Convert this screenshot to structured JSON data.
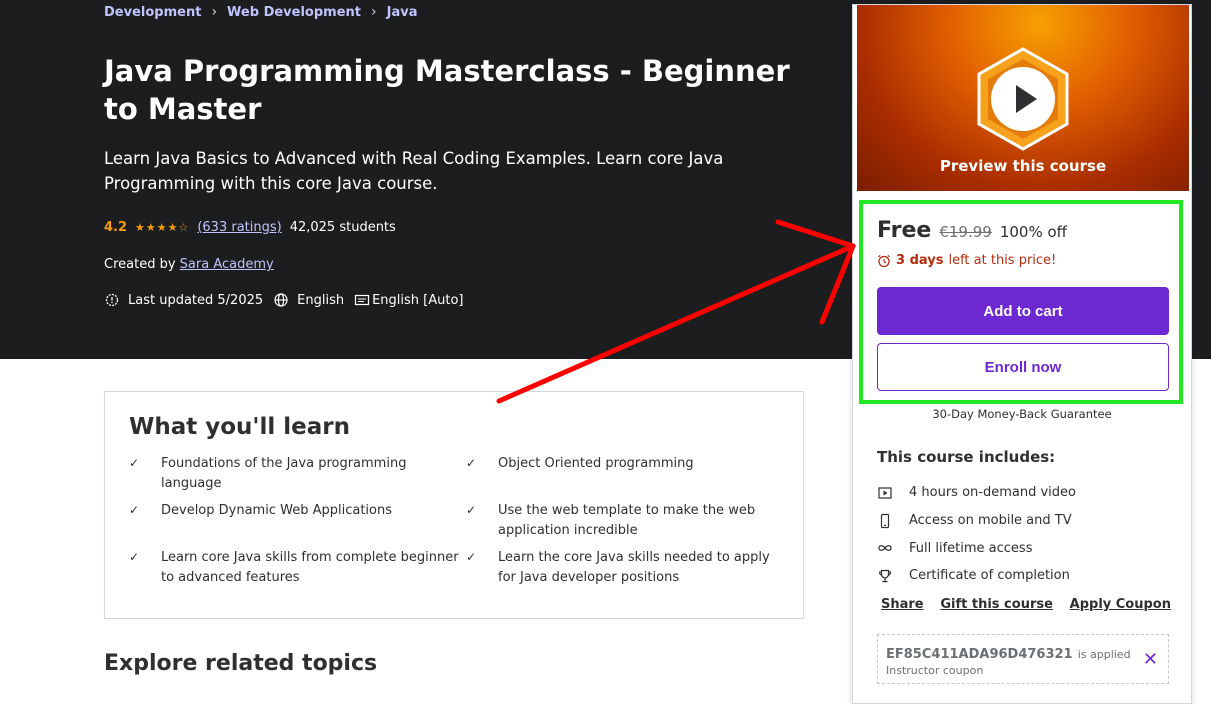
{
  "breadcrumb": [
    "Development",
    "Web Development",
    "Java"
  ],
  "course": {
    "title": "Java Programming Masterclass - Beginner to Master",
    "subtitle": "Learn Java Basics to Advanced with Real Coding Examples. Learn core Java Programming with this core Java course.",
    "rating": "4.2",
    "ratings_count": "(633 ratings)",
    "students": "42,025 students",
    "created_by_label": "Created by",
    "instructor": "Sara Academy",
    "last_updated": "Last updated 5/2025",
    "language": "English",
    "captions": "English [Auto]"
  },
  "card": {
    "preview_label": "Preview this course",
    "price": "Free",
    "original_price": "€19.99",
    "discount": "100% off",
    "timer_bold": "3 days",
    "timer_rest": "left at this price!",
    "add_to_cart": "Add to cart",
    "enroll_now": "Enroll now",
    "guarantee": "30-Day Money-Back Guarantee",
    "includes_title": "This course includes:",
    "includes": [
      {
        "icon": "video-icon",
        "text": "4 hours on-demand video"
      },
      {
        "icon": "mobile-icon",
        "text": "Access on mobile and TV"
      },
      {
        "icon": "infinity-icon",
        "text": "Full lifetime access"
      },
      {
        "icon": "trophy-icon",
        "text": "Certificate of completion"
      }
    ],
    "share": "Share",
    "gift": "Gift this course",
    "apply_coupon": "Apply Coupon",
    "coupon_code": "EF85C411ADA96D476321",
    "coupon_applied": "is applied",
    "coupon_type": "Instructor coupon"
  },
  "learn": {
    "title": "What you'll learn",
    "items": [
      "Foundations of the Java programming language",
      "Object Oriented programming",
      "Develop Dynamic Web Applications",
      "Use the web template to make the web application incredible",
      "Learn core Java skills from complete beginner to advanced features",
      "Learn the core Java skills needed to apply for Java developer positions"
    ]
  },
  "explore_title": "Explore related topics",
  "colors": {
    "hero_bg": "#1c1d1f",
    "accent_purple": "#6d28d2",
    "link_lavender": "#c0c4fc",
    "star_orange": "#f69c08",
    "annotation_green": "#22e822",
    "annotation_red": "#ff0000"
  }
}
